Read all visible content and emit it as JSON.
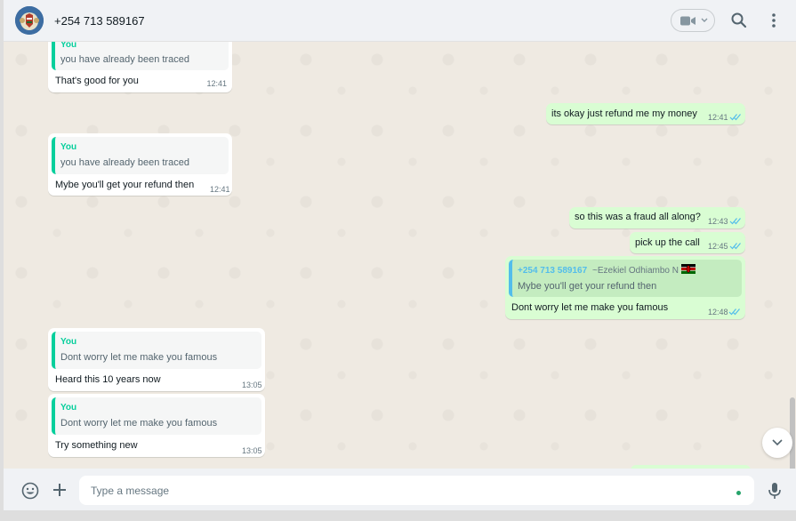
{
  "contact": {
    "name": "+254 713 589167",
    "avatar_icon": "kenya-coat-of-arms-avatar"
  },
  "header_icons": [
    "video-call-icon",
    "chevron-down-icon",
    "search-icon",
    "menu-icon"
  ],
  "messages": [
    {
      "dir": "in",
      "quote_author": "You",
      "quote_text": "you have already been traced",
      "text": "That's good for you",
      "time": "12:41"
    },
    {
      "dir": "out",
      "text": "its okay just refund me my money",
      "time": "12:41"
    },
    {
      "dir": "in",
      "quote_author": "You",
      "quote_text": "you have already been traced",
      "text": "Mybe you'll get your refund then",
      "time": "12:41"
    },
    {
      "dir": "out",
      "text": "so this was a fraud all along?",
      "time": "12:43"
    },
    {
      "dir": "out",
      "text": "pick up the call",
      "time": "12:45"
    },
    {
      "dir": "out",
      "quote_author": "+254 713 589167",
      "quote_author_alias": "~Ezekiel Odhiambo N",
      "quote_text": "Mybe you'll get your refund then",
      "text": "Dont worry let me  make you famous",
      "time": "12:48"
    },
    {
      "dir": "in",
      "quote_author": "You",
      "quote_text": "Dont worry let me  make you famous",
      "text": "Heard this 10 years now",
      "time": "13:05"
    },
    {
      "dir": "in",
      "quote_author": "You",
      "quote_text": "Dont worry let me  make you famous",
      "text": "Try something new",
      "time": "13:05"
    }
  ],
  "composer": {
    "placeholder": "Type a message"
  },
  "colors": {
    "incoming": "#ffffff",
    "outgoing": "#d9fdd3",
    "accent": "#06cf9c",
    "read_ticks": "#53bdeb"
  }
}
